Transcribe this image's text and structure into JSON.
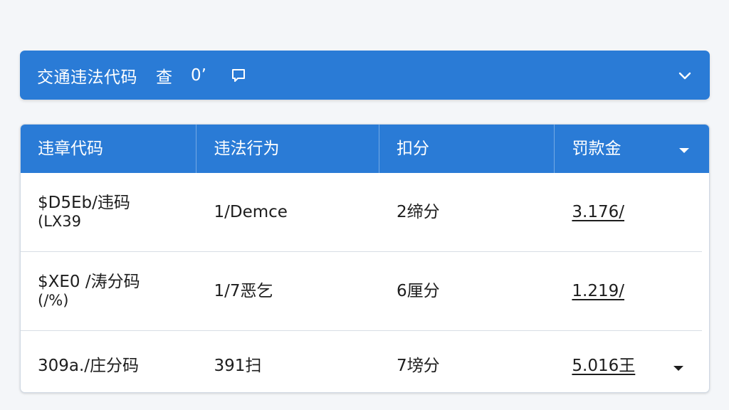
{
  "search_bar": {
    "title": "交通违法代码",
    "query_label": "查",
    "count_text": "0’"
  },
  "table": {
    "headers": [
      "违章代码",
      "违法行为",
      "扣分",
      "罚款金"
    ],
    "rows": [
      {
        "code_line1": "$D5Eb/违码",
        "code_line2": "(LX39",
        "behavior": "1/Demce",
        "points": "2缔分",
        "fine": "3.176/"
      },
      {
        "code_line1": "$XE0 /涛分码",
        "code_line2": "(/%)",
        "behavior": "1/7恶乞",
        "points": "6厘分",
        "fine": "1.219/"
      },
      {
        "code_line1": "309a./庄分码",
        "code_line2": "",
        "behavior": "391扫",
        "points": "7塝分",
        "fine": "5.016王"
      }
    ]
  },
  "colors": {
    "accent": "#2a7bd6",
    "background": "#f4f6f9",
    "row_divider": "#d7dde5"
  },
  "icons": {
    "chat": "chat-bubble-icon",
    "collapse": "chevron-down-icon",
    "sort": "caret-down-icon",
    "row_dropdown": "caret-down-icon"
  }
}
